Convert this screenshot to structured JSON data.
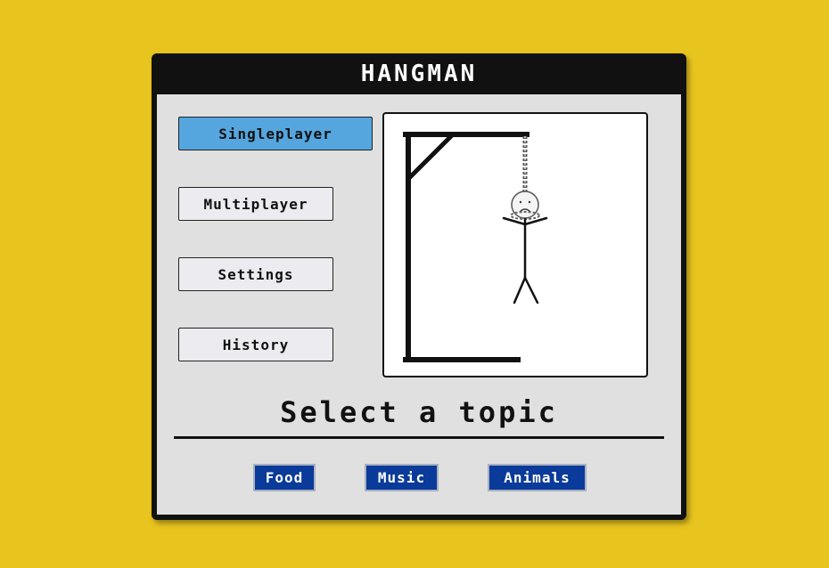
{
  "app": {
    "title": "HANGMAN"
  },
  "menu": {
    "items": [
      {
        "label": "Singleplayer",
        "active": true
      },
      {
        "label": "Multiplayer",
        "active": false
      },
      {
        "label": "Settings",
        "active": false
      },
      {
        "label": "History",
        "active": false
      }
    ]
  },
  "main": {
    "prompt": "Select a topic",
    "topics": [
      {
        "label": "Food"
      },
      {
        "label": "Music"
      },
      {
        "label": "Animals"
      }
    ]
  },
  "colors": {
    "background": "#e8c41f",
    "titlebar": "#111111",
    "panel": "#e0e0e0",
    "active_button": "#55a6de",
    "topic_button": "#0a3a9a"
  },
  "icons": {
    "hangman_drawing": "gallows-with-sad-stick-figure"
  }
}
